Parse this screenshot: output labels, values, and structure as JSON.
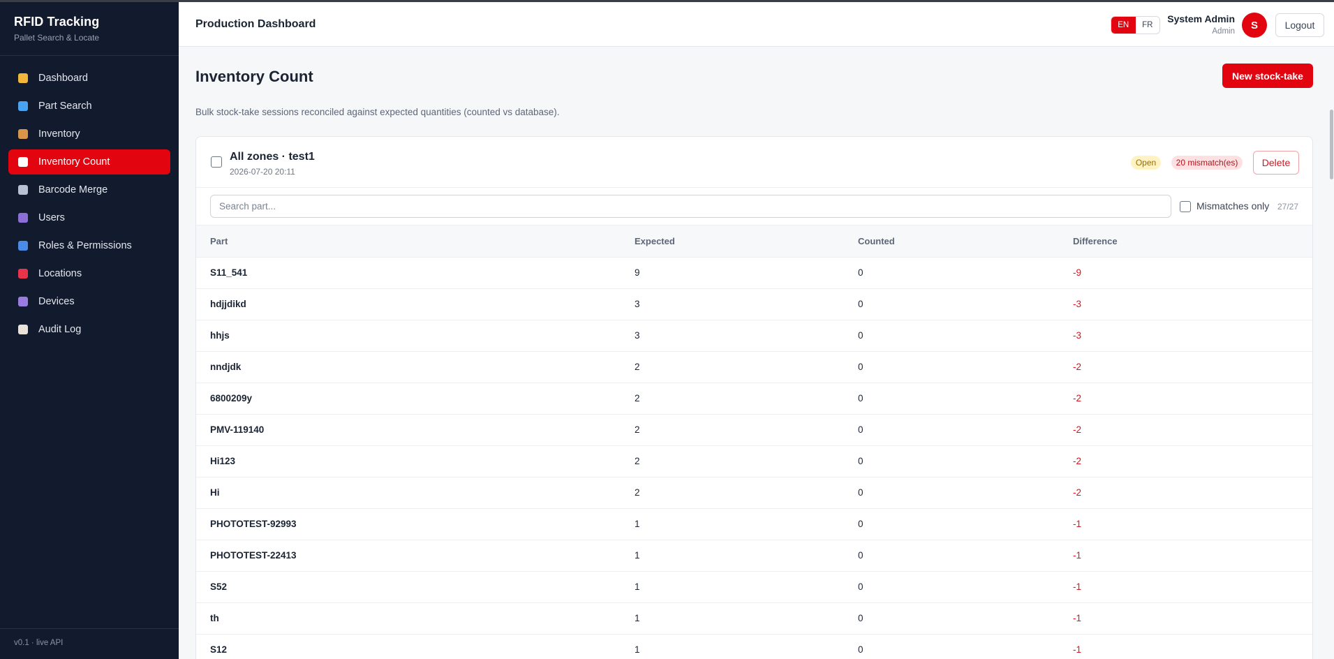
{
  "sidebar": {
    "brand_title": "RFID Tracking",
    "brand_subtitle": "Pallet Search & Locate",
    "items": [
      {
        "label": "Dashboard",
        "icon": "bar-chart-icon",
        "color": "#f2b63a"
      },
      {
        "label": "Part Search",
        "icon": "magnifier-icon",
        "color": "#4aa3f0"
      },
      {
        "label": "Inventory",
        "icon": "package-icon",
        "color": "#d9954a"
      },
      {
        "label": "Inventory Count",
        "icon": "clipboard-icon",
        "color": "#ffffff"
      },
      {
        "label": "Barcode Merge",
        "icon": "link-icon",
        "color": "#b9c2d2"
      },
      {
        "label": "Users",
        "icon": "users-icon",
        "color": "#8c6fd6"
      },
      {
        "label": "Roles & Permissions",
        "icon": "shield-icon",
        "color": "#4a8be8"
      },
      {
        "label": "Locations",
        "icon": "pin-icon",
        "color": "#e8344a"
      },
      {
        "label": "Devices",
        "icon": "device-icon",
        "color": "#9a7be0"
      },
      {
        "label": "Audit Log",
        "icon": "document-icon",
        "color": "#e8e2d8"
      }
    ],
    "active_index": 3,
    "footer": "v0.1 · live API"
  },
  "header": {
    "title": "Production Dashboard",
    "lang_en": "EN",
    "lang_fr": "FR",
    "active_lang": "EN",
    "user_name": "System Admin",
    "user_role": "Admin",
    "avatar_initial": "S",
    "logout_label": "Logout"
  },
  "main": {
    "title": "Inventory Count",
    "new_button": "New stock-take",
    "description": "Bulk stock-take sessions reconciled against expected quantities (counted vs database).",
    "session": {
      "title": "All zones · test1",
      "date": "2026-07-20 20:11",
      "status": "Open",
      "mismatch_badge": "20 mismatch(es)",
      "delete_label": "Delete"
    },
    "search_placeholder": "Search part...",
    "mismatches_only_label": "Mismatches only",
    "count": "27/27",
    "table": {
      "headers": [
        "Part",
        "Expected",
        "Counted",
        "Difference"
      ],
      "rows": [
        [
          "S11_541",
          "9",
          "0",
          "-9"
        ],
        [
          "hdjjdikd",
          "3",
          "0",
          "-3"
        ],
        [
          "hhjs",
          "3",
          "0",
          "-3"
        ],
        [
          "nndjdk",
          "2",
          "0",
          "-2"
        ],
        [
          "6800209y",
          "2",
          "0",
          "-2"
        ],
        [
          "PMV-119140",
          "2",
          "0",
          "-2"
        ],
        [
          "Hi123",
          "2",
          "0",
          "-2"
        ],
        [
          "Hi",
          "2",
          "0",
          "-2"
        ],
        [
          "PHOTOTEST-92993",
          "1",
          "0",
          "-1"
        ],
        [
          "PHOTOTEST-22413",
          "1",
          "0",
          "-1"
        ],
        [
          "S52",
          "1",
          "0",
          "-1"
        ],
        [
          "th",
          "1",
          "0",
          "-1"
        ],
        [
          "S12",
          "1",
          "0",
          "-1"
        ]
      ]
    }
  },
  "colors": {
    "accent": "#e2040f",
    "sidebar_bg": "#121a2d",
    "negative": "#d9141e"
  }
}
